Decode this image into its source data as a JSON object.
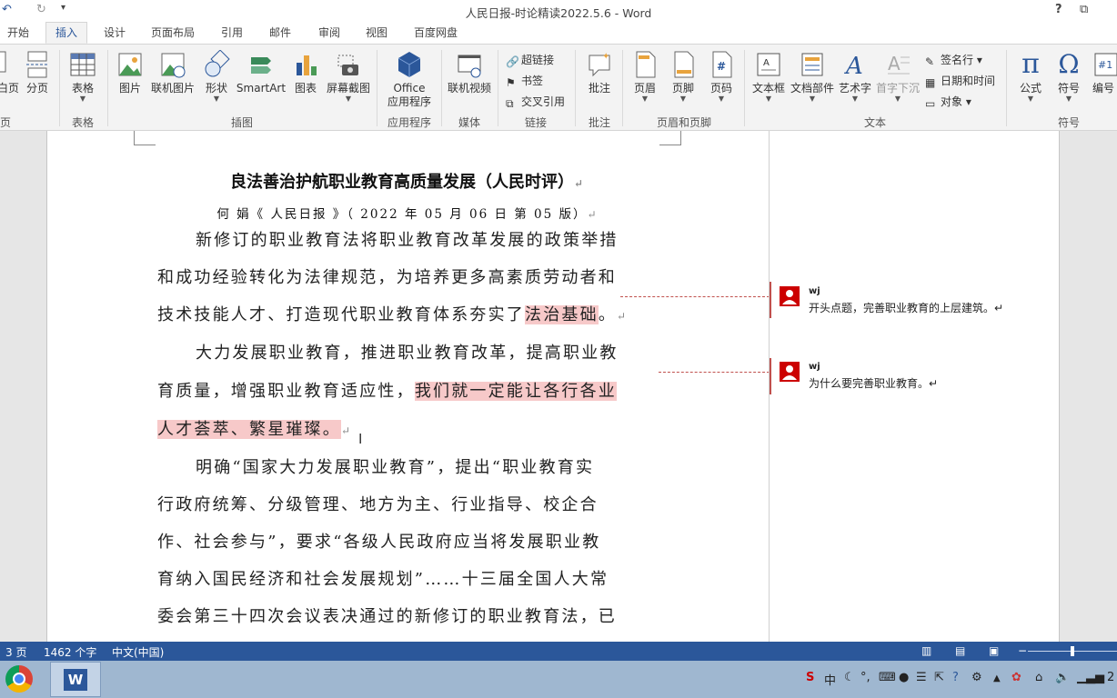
{
  "window": {
    "title": "人民日报-时论精读2022.5.6 - Word",
    "help": "?",
    "restore": "⧉",
    "undo": "↶",
    "redo": "↻",
    "qa_more": "▾"
  },
  "tabs": [
    "开始",
    "插入",
    "设计",
    "页面布局",
    "引用",
    "邮件",
    "审阅",
    "视图",
    "百度网盘"
  ],
  "active_tab": "插入",
  "ribbon": {
    "pages": {
      "blank": "白页",
      "break": "分页",
      "group": "页面"
    },
    "table": {
      "label": "表格",
      "group": "表格"
    },
    "illustrations": {
      "picture": "图片",
      "online_picture": "联机图片",
      "shapes": "形状",
      "smartart": "SmartArt",
      "chart": "图表",
      "screenshot": "屏幕截图",
      "group": "插图"
    },
    "apps": {
      "office_line1": "Office",
      "office_line2": "应用程序",
      "group": "应用程序"
    },
    "media": {
      "online_video": "联机视频",
      "group": "媒体"
    },
    "links": {
      "hyperlink": "超链接",
      "bookmark": "书签",
      "crossref": "交叉引用",
      "group": "链接"
    },
    "comments": {
      "comment": "批注",
      "group": "批注"
    },
    "header_footer": {
      "header": "页眉",
      "footer": "页脚",
      "page_number": "页码",
      "group": "页眉和页脚"
    },
    "text": {
      "textbox": "文本框",
      "quick_parts": "文档部件",
      "wordart": "艺术字",
      "dropcap": "首字下沉",
      "signature": "签名行",
      "datetime": "日期和时间",
      "object": "对象",
      "group": "文本"
    },
    "symbols": {
      "equation": "公式",
      "symbol": "符号",
      "number": "编号",
      "group": "符号"
    }
  },
  "document": {
    "title": "良法善治护航职业教育高质量发展（人民时评）",
    "byline": "何  娟《 人民日报 》（ 2022 年 05 月 06 日   第 05 版）",
    "p1_l1": "新修订的职业教育法将职业教育改革发展的政策举措",
    "p1_l2": "和成功经验转化为法律规范，为培养更多高素质劳动者和",
    "p1_l3_a": "技术技能人才、打造现代职业教育体系夯实了",
    "p1_l3_hl": "法治基础",
    "p1_l3_b": "。",
    "p2_l1": "大力发展职业教育，推进职业教育改革，提高职业教",
    "p2_l2_a": "育质量，增强职业教育适应性，",
    "p2_l2_hl": "我们就一定能让各行各业",
    "p2_l3_hl": "人才荟萃、繁星璀璨。",
    "p3_l1": "明确“国家大力发展职业教育”，提出“职业教育实",
    "p3_l2": "行政府统筹、分级管理、地方为主、行业指导、校企合",
    "p3_l3": "作、社会参与”，要求“各级人民政府应当将发展职业教",
    "p3_l4": "育纳入国民经济和社会发展规划”……十三届全国人大常",
    "p3_l5": "委会第三十四次会议表决通过的新修订的职业教育法，已",
    "para_mark": "↵"
  },
  "comments": [
    {
      "author": "wj",
      "text": "开头点题，完善职业教育的上层建筑。↵"
    },
    {
      "author": "wj",
      "text": "为什么要完善职业教育。↵"
    }
  ],
  "status": {
    "page": "3 页",
    "words": "1462 个字",
    "language": "中文(中国)"
  },
  "taskbar": {
    "word_letter": "W",
    "tray_ime": "中",
    "clock_partial": "2"
  },
  "colors": {
    "accent": "#2b579a",
    "highlight": "#f7c9c9",
    "comment": "#c0504d"
  }
}
